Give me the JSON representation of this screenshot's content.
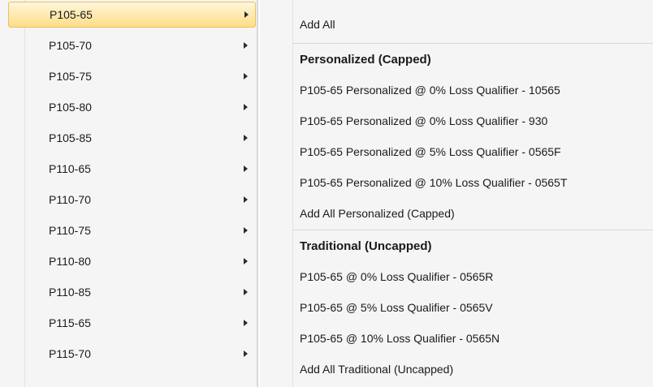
{
  "left_menu": {
    "items": [
      {
        "label": "P105-65",
        "selected": true
      },
      {
        "label": "P105-70"
      },
      {
        "label": "P105-75"
      },
      {
        "label": "P105-80"
      },
      {
        "label": "P105-85"
      },
      {
        "label": "P110-65"
      },
      {
        "label": "P110-70"
      },
      {
        "label": "P110-75"
      },
      {
        "label": "P110-80"
      },
      {
        "label": "P110-85"
      },
      {
        "label": "P115-65"
      },
      {
        "label": "P115-70"
      }
    ],
    "submenu_icon": "chevron-right-icon"
  },
  "submenu": {
    "add_all": "Add All",
    "personalized_header": "Personalized (Capped)",
    "personalized_items": [
      "P105-65 Personalized @ 0% Loss Qualifier - 10565",
      "P105-65 Personalized @ 0% Loss Qualifier - 930",
      "P105-65 Personalized @ 5% Loss Qualifier - 0565F",
      "P105-65 Personalized @ 10% Loss Qualifier - 0565T"
    ],
    "add_all_personalized": "Add All Personalized (Capped)",
    "traditional_header": "Traditional (Uncapped)",
    "traditional_items": [
      "P105-65 @ 0% Loss Qualifier - 0565R",
      "P105-65 @ 5% Loss Qualifier - 0565V",
      "P105-65 @ 10% Loss Qualifier - 0565N"
    ],
    "add_all_traditional": "Add All Traditional (Uncapped)"
  },
  "colors": {
    "menu_bg": "#f5f5f5",
    "selected_highlight": "#fddd86",
    "selected_border": "#e8c157"
  }
}
